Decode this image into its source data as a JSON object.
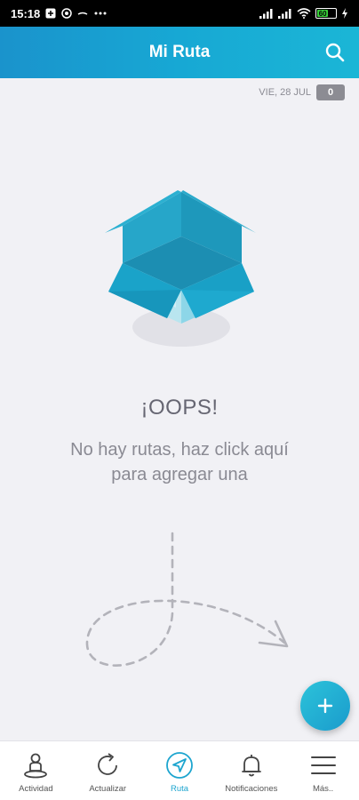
{
  "status_bar": {
    "time": "15:18",
    "battery_level": "60",
    "icons": [
      "notification-box-icon",
      "whatsapp-icon",
      "minus-icon",
      "more-dots-icon",
      "signal-icon",
      "signal-icon",
      "wifi-icon",
      "battery-icon",
      "charging-icon"
    ]
  },
  "header": {
    "title": "Mi Ruta",
    "search_icon": "search-icon"
  },
  "date_bar": {
    "date": "VIE, 28 JUL",
    "count": "0"
  },
  "empty_state": {
    "title": "¡OOPS!",
    "message": "No hay rutas, haz click aquí para agregar una",
    "illustration": "open-box-icon"
  },
  "fab": {
    "icon": "plus-icon",
    "color": "#1fb0d6"
  },
  "bottom_nav": {
    "items": [
      {
        "label": "Actividad",
        "icon": "person-location-icon",
        "active": false
      },
      {
        "label": "Actualizar",
        "icon": "refresh-icon",
        "active": false
      },
      {
        "label": "Ruta",
        "icon": "navigation-arrow-icon",
        "active": true
      },
      {
        "label": "Notificaciones",
        "icon": "bell-icon",
        "active": false
      },
      {
        "label": "Más..",
        "icon": "menu-icon",
        "active": false
      }
    ]
  },
  "colors": {
    "accent": "#1da5cf",
    "header_start": "#1a93cc",
    "header_end": "#1bb6d6",
    "background": "#f1f1f5"
  }
}
